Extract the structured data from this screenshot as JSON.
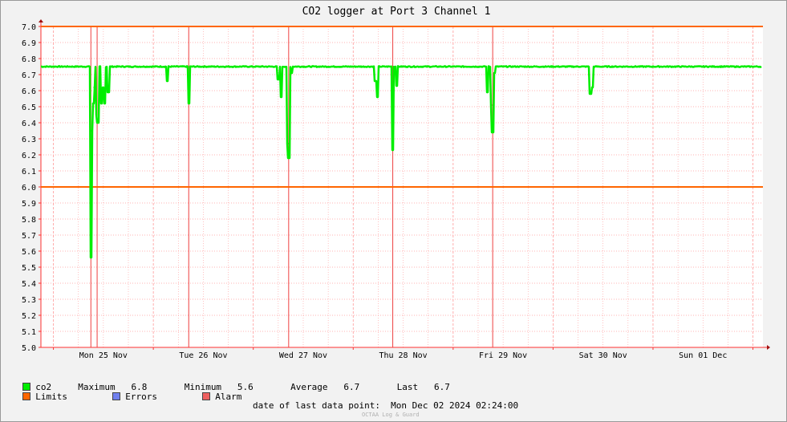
{
  "chart_data": {
    "type": "line",
    "title": "CO2 logger at Port 3 Channel 1",
    "xlabel": "",
    "ylabel": "",
    "ylim": [
      5.0,
      7.0
    ],
    "yticks": [
      "7.0",
      "6.9",
      "6.8",
      "6.7",
      "6.6",
      "6.5",
      "6.4",
      "6.3",
      "6.2",
      "6.1",
      "6.0",
      "5.9",
      "5.8",
      "5.7",
      "5.6",
      "5.5",
      "5.4",
      "5.3",
      "5.2",
      "5.1",
      "5.0"
    ],
    "xlim": [
      "2024-11-24 21:00",
      "2024-12-02 02:24"
    ],
    "xticks": [
      {
        "date": "2024-11-25 12:00",
        "label": "Mon 25 Nov"
      },
      {
        "date": "2024-11-26 12:00",
        "label": "Tue 26 Nov"
      },
      {
        "date": "2024-11-27 12:00",
        "label": "Wed 27 Nov"
      },
      {
        "date": "2024-11-28 12:00",
        "label": "Thu 28 Nov"
      },
      {
        "date": "2024-11-29 12:00",
        "label": "Fri 29 Nov"
      },
      {
        "date": "2024-11-30 12:00",
        "label": "Sat 30 Nov"
      },
      {
        "date": "2024-12-01 12:00",
        "label": "Sun 01 Dec"
      }
    ],
    "grid": true,
    "limits": [
      7.0,
      6.0
    ],
    "alarm_times": [
      "2024-11-25 09:00",
      "2024-11-25 10:30",
      "2024-11-26 08:30",
      "2024-11-27 08:30",
      "2024-11-28 09:30",
      "2024-11-29 09:30"
    ],
    "series": [
      {
        "name": "co2",
        "color": "#00ee00",
        "baseline": 6.75,
        "dips": [
          [
            "2024-11-25 09:00",
            5.56
          ],
          [
            "2024-11-25 09:10",
            6.35
          ],
          [
            "2024-11-25 09:30",
            6.52
          ],
          [
            "2024-11-25 09:50",
            6.62
          ],
          [
            "2024-11-25 10:20",
            6.45
          ],
          [
            "2024-11-25 10:40",
            6.4
          ],
          [
            "2024-11-25 11:30",
            6.52
          ],
          [
            "2024-11-25 12:00",
            6.62
          ],
          [
            "2024-11-25 12:20",
            6.52
          ],
          [
            "2024-11-25 13:10",
            6.59
          ],
          [
            "2024-11-26 03:20",
            6.66
          ],
          [
            "2024-11-26 08:30",
            6.52
          ],
          [
            "2024-11-27 06:00",
            6.67
          ],
          [
            "2024-11-27 06:40",
            6.56
          ],
          [
            "2024-11-27 08:15",
            6.27
          ],
          [
            "2024-11-27 08:30",
            6.18
          ],
          [
            "2024-11-27 09:10",
            6.71
          ],
          [
            "2024-11-28 05:20",
            6.66
          ],
          [
            "2024-11-28 05:50",
            6.56
          ],
          [
            "2024-11-28 09:30",
            6.23
          ],
          [
            "2024-11-28 10:30",
            6.63
          ],
          [
            "2024-11-29 08:10",
            6.59
          ],
          [
            "2024-11-29 09:10",
            6.51
          ],
          [
            "2024-11-29 09:30",
            6.34
          ],
          [
            "2024-11-29 10:00",
            6.71
          ],
          [
            "2024-11-30 09:00",
            6.58
          ],
          [
            "2024-11-30 09:20",
            6.62
          ]
        ]
      }
    ]
  },
  "legend": {
    "co2_label": "co2",
    "stats": "Maximum   6.8       Minimum   5.6       Average   6.7       Last   6.7",
    "limits_label": "Limits",
    "errors_label": "Errors",
    "alarm_label": "Alarm",
    "colors": {
      "co2": "#00ee00",
      "limits": "#ff6600",
      "errors": "#7080ee",
      "alarm": "#ee6060"
    }
  },
  "footer": {
    "last_point": "date of last data point:  Mon Dec 02 2024 02:24:00",
    "credit": "OCTAA Log & Guard"
  }
}
